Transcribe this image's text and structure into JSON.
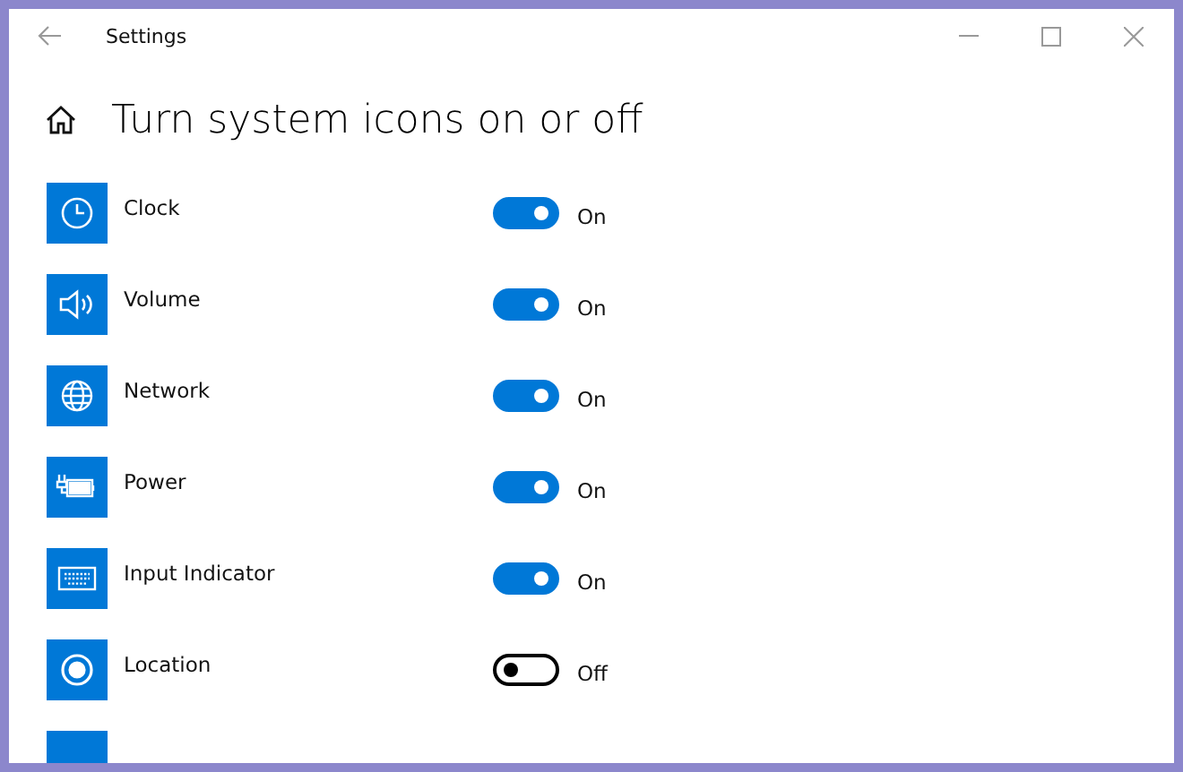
{
  "window": {
    "title": "Settings"
  },
  "page": {
    "heading": "Turn system icons on or off"
  },
  "items": [
    {
      "label": "Clock",
      "on": true,
      "status": "On"
    },
    {
      "label": "Volume",
      "on": true,
      "status": "On"
    },
    {
      "label": "Network",
      "on": true,
      "status": "On"
    },
    {
      "label": "Power",
      "on": true,
      "status": "On"
    },
    {
      "label": "Input Indicator",
      "on": true,
      "status": "On"
    },
    {
      "label": "Location",
      "on": false,
      "status": "Off"
    }
  ]
}
